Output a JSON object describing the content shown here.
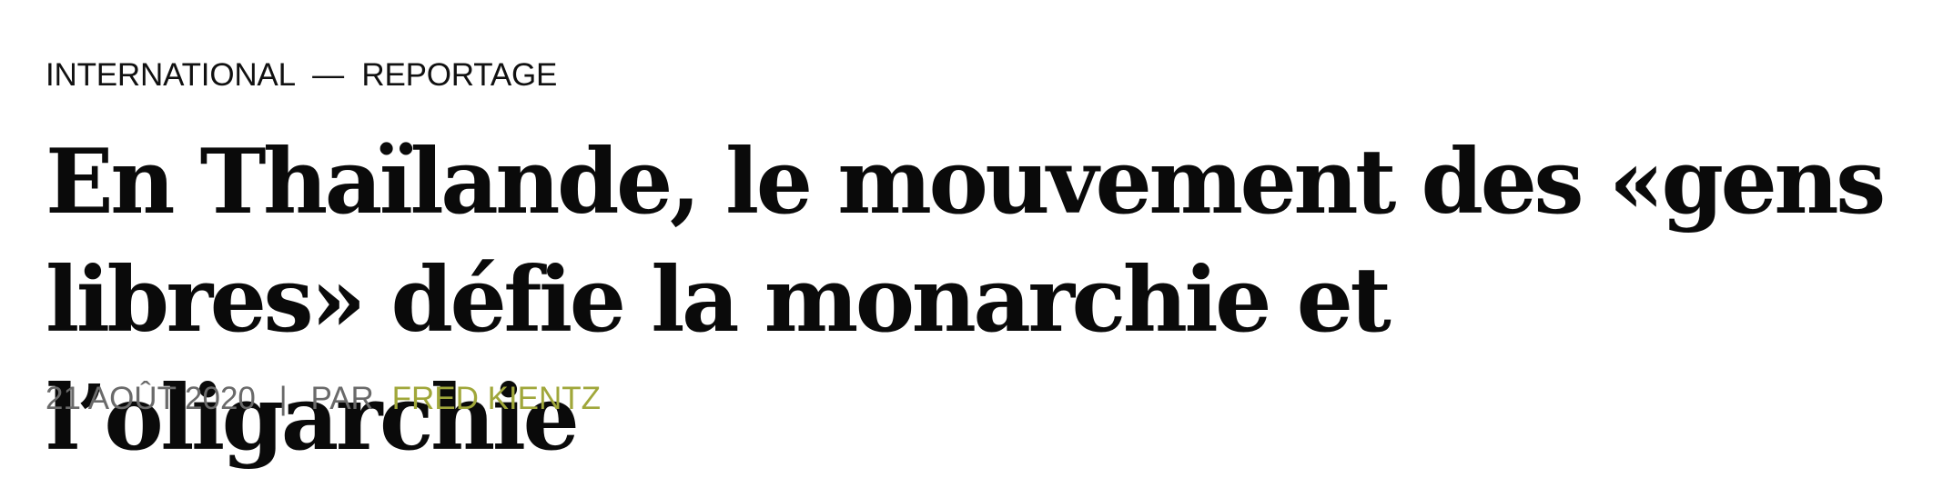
{
  "kicker": {
    "section": "INTERNATIONAL",
    "separator": "—",
    "genre": "REPORTAGE"
  },
  "headline": "En Thaïlande, le mouvement des «gens libres» défie la monarchie et l’oligarchie",
  "meta": {
    "date": "21 AOÛT 2020",
    "separator": "|",
    "by_label": "PAR",
    "author": "FRED KIENTZ"
  },
  "colors": {
    "text": "#0a0a0a",
    "meta_text": "#6a6a6a",
    "author_link": "#a0a73a"
  }
}
